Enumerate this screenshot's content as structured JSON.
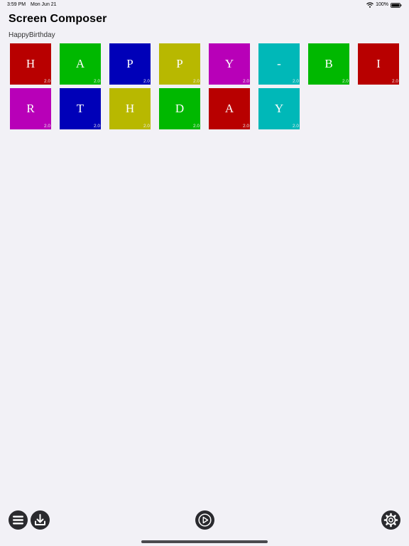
{
  "status_bar": {
    "time": "3:59 PM",
    "date": "Mon Jun 21",
    "battery_percent": "100%",
    "icons": [
      "wifi-icon",
      "battery-icon"
    ]
  },
  "header": {
    "title": "Screen Composer",
    "project_name": "HappyBirthday"
  },
  "tiles": [
    {
      "letter": "H",
      "duration": "2.0",
      "color": "#b80000"
    },
    {
      "letter": "A",
      "duration": "2.0",
      "color": "#00b800"
    },
    {
      "letter": "P",
      "duration": "2.0",
      "color": "#0000b8"
    },
    {
      "letter": "P",
      "duration": "2.0",
      "color": "#b8b800"
    },
    {
      "letter": "Y",
      "duration": "2.0",
      "color": "#b800b8"
    },
    {
      "letter": "-",
      "duration": "2.0",
      "color": "#00b8b8"
    },
    {
      "letter": "B",
      "duration": "2.0",
      "color": "#00b800"
    },
    {
      "letter": "I",
      "duration": "2.0",
      "color": "#b80000"
    },
    {
      "letter": "R",
      "duration": "2.0",
      "color": "#b800b8"
    },
    {
      "letter": "T",
      "duration": "2.0",
      "color": "#0000b8"
    },
    {
      "letter": "H",
      "duration": "2.0",
      "color": "#b8b800"
    },
    {
      "letter": "D",
      "duration": "2.0",
      "color": "#00b800"
    },
    {
      "letter": "A",
      "duration": "2.0",
      "color": "#b80000"
    },
    {
      "letter": "Y",
      "duration": "2.0",
      "color": "#00b8b8"
    }
  ],
  "toolbar": {
    "buttons": [
      {
        "name": "menu-button",
        "icon": "list-icon"
      },
      {
        "name": "download-button",
        "icon": "download-icon"
      },
      {
        "name": "play-button",
        "icon": "play-icon"
      },
      {
        "name": "settings-button",
        "icon": "gear-icon"
      }
    ],
    "button_color": "#2a2a2e",
    "background": "#f2f1f6"
  }
}
